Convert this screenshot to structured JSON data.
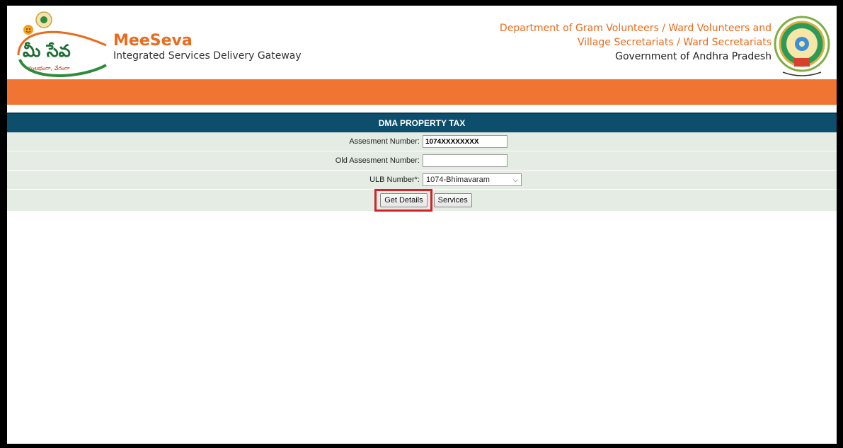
{
  "header": {
    "brand_title": "MeeSeva",
    "brand_subtitle": "Integrated Services Delivery Gateway",
    "logo_text": "మీ సేవ",
    "logo_tagline": "సులభంగా, వేగంగా",
    "department_line1": "Department of Gram Volunteers / Ward Volunteers and",
    "department_line2": "Village Secretariats / Ward Secretariats",
    "government": "Government of Andhra Pradesh"
  },
  "form": {
    "title": "DMA PROPERTY TAX",
    "fields": [
      {
        "label": "Assesment Number:",
        "value": "1074XXXXXXXX"
      },
      {
        "label": "Old Assesment Number:",
        "value": ""
      },
      {
        "label": "ULB Number*:",
        "value": "1074-Bhimavaram"
      }
    ],
    "buttons": {
      "get_details": "Get Details",
      "services": "Services"
    }
  },
  "colors": {
    "accent_orange": "#f07432",
    "header_blue": "#0d4e6d",
    "row_bg": "#e4ece4",
    "highlight_red": "#d3222a"
  }
}
